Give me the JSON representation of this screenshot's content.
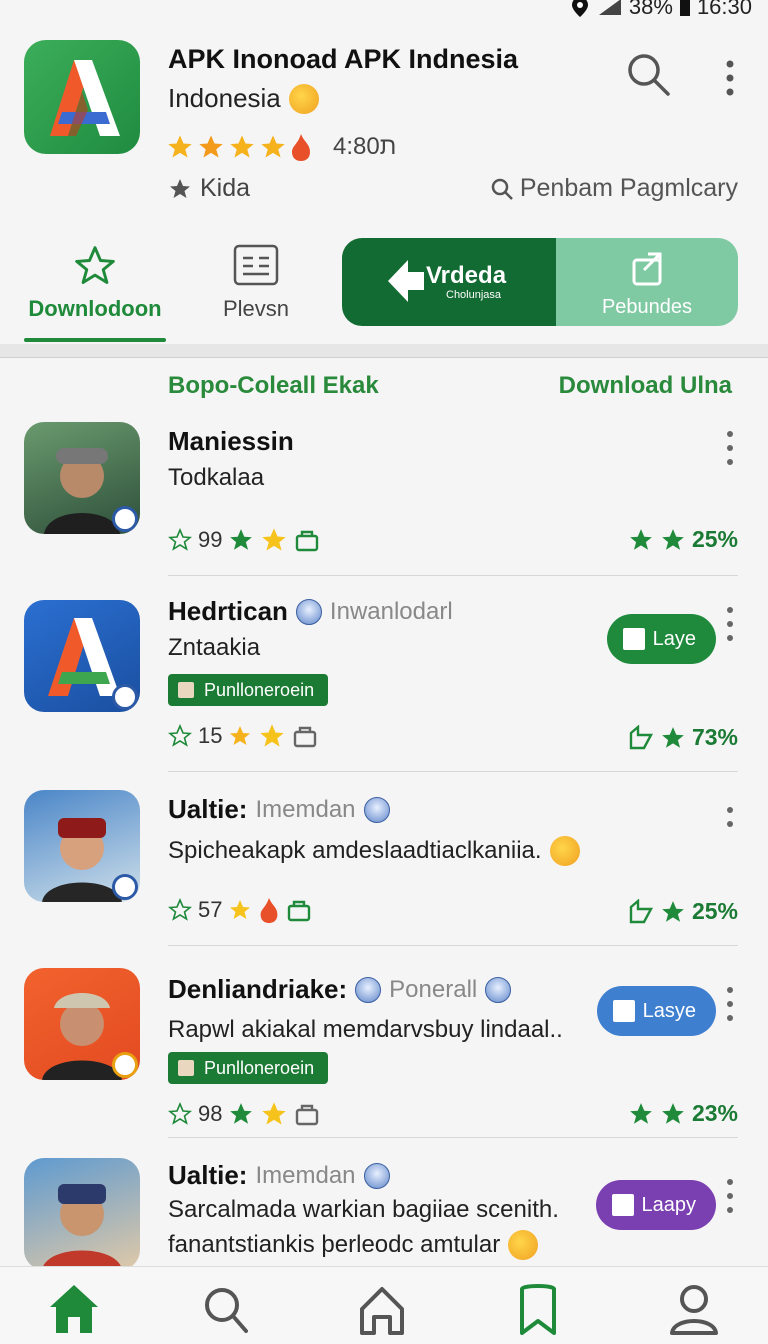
{
  "status": {
    "battery": "38%",
    "time": "16:30"
  },
  "app": {
    "title": "APK Inonoad APK Indnesia",
    "subtitle": "Indonesia",
    "rating": "4:8ת0",
    "category": "Kida",
    "search_hint": "Penbam Pagmlcary"
  },
  "tabs": {
    "download": "Downlodoon",
    "preview": "Plevsn",
    "segment_primary_title": "Vrdeda",
    "segment_primary_sub": "Cholunjasa",
    "segment_secondary": "Pebundes"
  },
  "section": {
    "left": "Bopo-Coleall Ekak",
    "right": "Download Ulna"
  },
  "items": [
    {
      "title": "Maniessin",
      "desc": "Todkalaa",
      "count": "99",
      "score": "25%"
    },
    {
      "title": "Hedrtican",
      "aside": "Inwanlodarl",
      "desc": "Zntaakia",
      "tag": "Punllonerоein",
      "button": "Laye",
      "count": "15",
      "score": "73%"
    },
    {
      "title": "Ualtie:",
      "aside": "Imemdan",
      "desc": "Spicheakapk amdeslaadtiaclkaniia.",
      "count": "57",
      "score": "25%"
    },
    {
      "title": "Denliandriake:",
      "aside": "Ponerall",
      "desc": "Rapwl akiakal memdarvsbuy lindaal..",
      "tag": "Punllonerоein",
      "button": "Lasye",
      "count": "98",
      "score": "23%"
    },
    {
      "title": "Ualtie:",
      "aside": "Imemdan",
      "desc": "Sarcalmada warkian bagiiae scenith.",
      "desc2": "fanantstiankis þerleodc amtular",
      "button": "Laapy"
    }
  ],
  "colors": {
    "accent": "#1e8a3a",
    "dark_green": "#126b32",
    "mint": "#7fc9a3",
    "blue_pill": "#3f7fd0",
    "purple_pill": "#7a3fb0"
  }
}
